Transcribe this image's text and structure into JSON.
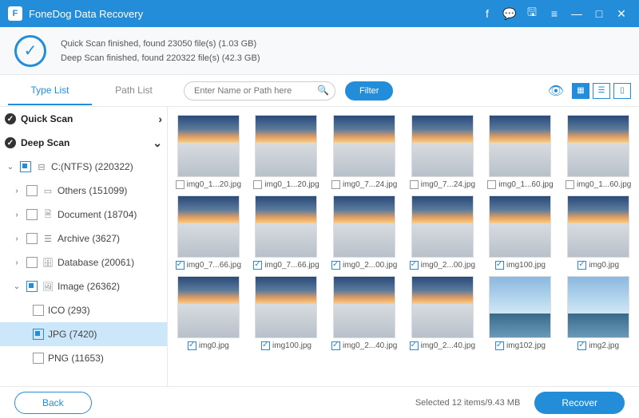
{
  "title": "FoneDog Data Recovery",
  "scan": {
    "line1": "Quick Scan finished, found 23050 file(s) (1.03 GB)",
    "line2": "Deep Scan finished, found 220322 file(s) (42.3 GB)"
  },
  "tabs": {
    "typelist": "Type List",
    "pathlist": "Path List"
  },
  "search": {
    "placeholder": "Enter Name or Path here"
  },
  "filter_label": "Filter",
  "sidebar": {
    "quickscan": "Quick Scan",
    "deepscan": "Deep Scan",
    "drive": "C:(NTFS) (220322)",
    "others": "Others (151099)",
    "document": "Document (18704)",
    "archive": "Archive (3627)",
    "database": "Database (20061)",
    "image": "Image (26362)",
    "ico": "ICO (293)",
    "jpg": "JPG (7420)",
    "png": "PNG (11653)"
  },
  "files": [
    {
      "name": "img0_1...20.jpg",
      "checked": false,
      "island": false
    },
    {
      "name": "img0_1...20.jpg",
      "checked": false,
      "island": false
    },
    {
      "name": "img0_7...24.jpg",
      "checked": false,
      "island": false
    },
    {
      "name": "img0_7...24.jpg",
      "checked": false,
      "island": false
    },
    {
      "name": "img0_1...60.jpg",
      "checked": false,
      "island": false
    },
    {
      "name": "img0_1...60.jpg",
      "checked": false,
      "island": false
    },
    {
      "name": "img0_7...66.jpg",
      "checked": true,
      "island": false
    },
    {
      "name": "img0_7...66.jpg",
      "checked": true,
      "island": false
    },
    {
      "name": "img0_2...00.jpg",
      "checked": true,
      "island": false
    },
    {
      "name": "img0_2...00.jpg",
      "checked": true,
      "island": false
    },
    {
      "name": "img100.jpg",
      "checked": true,
      "island": false
    },
    {
      "name": "img0.jpg",
      "checked": true,
      "island": false
    },
    {
      "name": "img0.jpg",
      "checked": true,
      "island": false
    },
    {
      "name": "img100.jpg",
      "checked": true,
      "island": false
    },
    {
      "name": "img0_2...40.jpg",
      "checked": true,
      "island": false
    },
    {
      "name": "img0_2...40.jpg",
      "checked": true,
      "island": false
    },
    {
      "name": "img102.jpg",
      "checked": true,
      "island": true
    },
    {
      "name": "img2.jpg",
      "checked": true,
      "island": true
    }
  ],
  "footer": {
    "back": "Back",
    "status": "Selected 12 items/9.43 MB",
    "recover": "Recover"
  }
}
